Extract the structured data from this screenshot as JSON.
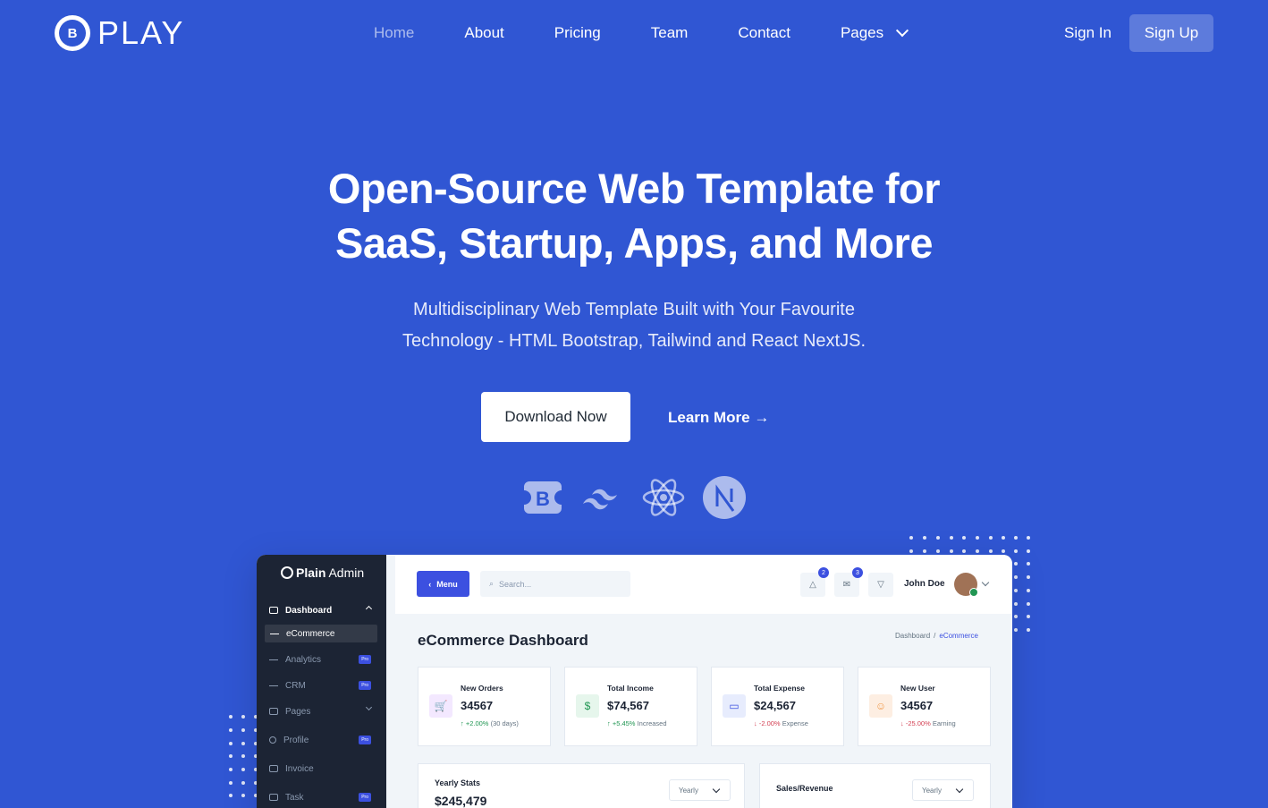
{
  "brand": {
    "logo_letter": "B",
    "name": "PLAY"
  },
  "nav": {
    "items": [
      {
        "label": "Home",
        "active": true
      },
      {
        "label": "About"
      },
      {
        "label": "Pricing"
      },
      {
        "label": "Team"
      },
      {
        "label": "Contact"
      }
    ],
    "pages_label": "Pages",
    "signin": "Sign In",
    "signup": "Sign Up"
  },
  "hero": {
    "title_line1": "Open-Source Web Template for",
    "title_line2": "SaaS, Startup, Apps, and More",
    "subtitle_line1": "Multidisciplinary Web Template Built with Your Favourite",
    "subtitle_line2": "Technology - HTML Bootstrap, Tailwind and React NextJS.",
    "primary_button": "Download Now",
    "secondary_button": "Learn More →"
  },
  "tech_icons": [
    "bootstrap-icon",
    "tailwind-icon",
    "react-icon",
    "nextjs-icon"
  ],
  "dashboard": {
    "logo_bold": "Plain",
    "logo_rest": "Admin",
    "sidebar": {
      "dashboard": "Dashboard",
      "ecommerce": "eCommerce",
      "analytics": "Analytics",
      "crm": "CRM",
      "pages": "Pages",
      "profile": "Profile",
      "invoice": "Invoice",
      "task": "Task",
      "pro_badge": "Pro"
    },
    "topbar": {
      "menu_label": "Menu",
      "search_placeholder": "Search...",
      "notif_count": "2",
      "mail_count": "3",
      "user_name": "John Doe"
    },
    "page_title": "eCommerce Dashboard",
    "breadcrumb": {
      "root": "Dashboard",
      "sep": "/",
      "current": "eCommerce"
    },
    "cards": [
      {
        "label": "New Orders",
        "value": "34567",
        "change": "↑ +2.00%",
        "note": "(30 days)"
      },
      {
        "label": "Total Income",
        "value": "$74,567",
        "change": "↑ +5.45%",
        "note": "Increased"
      },
      {
        "label": "Total Expense",
        "value": "$24,567",
        "change": "↓ -2.00%",
        "note": "Expense"
      },
      {
        "label": "New User",
        "value": "34567",
        "change": "↓ -25.00%",
        "note": "Earning"
      }
    ],
    "yearly": {
      "title": "Yearly Stats",
      "value": "$245,479",
      "select": "Yearly"
    },
    "sales": {
      "title": "Sales/Revenue",
      "select": "Yearly"
    }
  },
  "colors": {
    "background": "#3056D3",
    "dashboard_sidebar": "#1C2434",
    "accent": "#3C50E0",
    "success": "#219653",
    "danger": "#D34053"
  }
}
